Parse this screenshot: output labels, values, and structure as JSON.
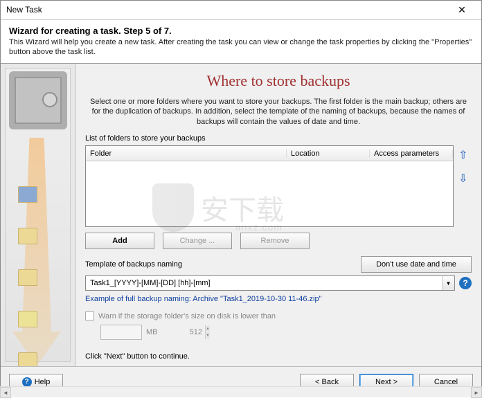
{
  "window": {
    "title": "New Task"
  },
  "header": {
    "title": "Wizard for creating a task. Step 5 of 7.",
    "description": "This Wizard will help you create a new task. After creating the task you can view or change the task properties by clicking the \"Properties\" button above the task list."
  },
  "main": {
    "title": "Where to store backups",
    "description": "Select one or more folders where you want to store your backups. The first folder is the main backup; others are for the duplication of backups. In addition, select the template of the naming of backups, because the names of backups will contain the values of date and time.",
    "list_label": "List of folders to store your backups",
    "columns": {
      "folder": "Folder",
      "location": "Location",
      "access": "Access parameters"
    },
    "buttons": {
      "add": "Add",
      "change": "Change ...",
      "remove": "Remove",
      "dont_use": "Don't use date and time"
    },
    "template_label": "Template of backups naming",
    "template_value": "Task1_[YYYY]-[MM]-[DD] [hh]-[mm]",
    "example": "Example of full backup naming: Archive \"Task1_2019-10-30 11-46.zip\"",
    "warn_label": "Warn if the storage folder's size on disk is lower than",
    "size_value": "512",
    "size_unit": "MB",
    "continue": "Click \"Next\" button to continue."
  },
  "footer": {
    "help": "Help",
    "back": "< Back",
    "next": "Next >",
    "cancel": "Cancel"
  },
  "watermark": {
    "text": "安下载",
    "sub": "anxz.com"
  }
}
